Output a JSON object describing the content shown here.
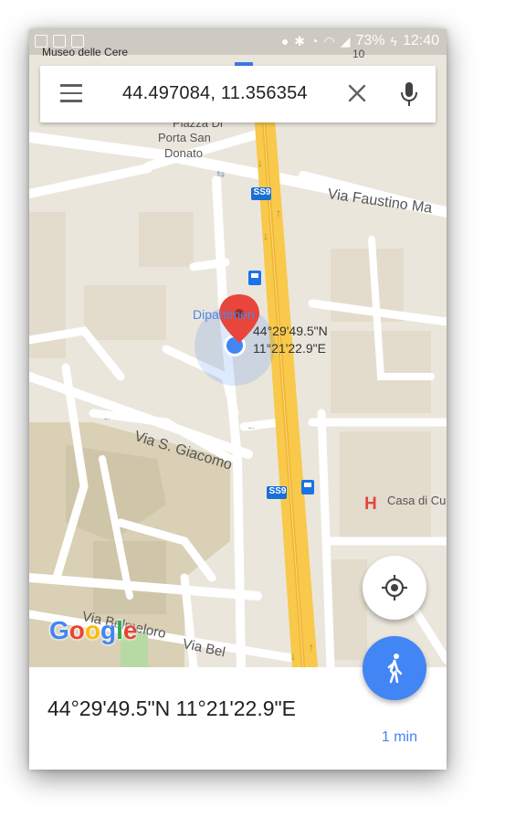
{
  "status_bar": {
    "battery": "73%",
    "time": "12:40"
  },
  "search": {
    "query": "44.497084, 11.356354"
  },
  "map": {
    "labels": {
      "museo": "Museo delle Cere",
      "piazza": "Piazza Di",
      "porta": "Porta San",
      "donato": "Donato",
      "faustino": "Via Faustino Ma",
      "dipart": "Dipartimen",
      "coord_lat": "44°29'49.5\"N",
      "coord_lng": "11°21'22.9\"E",
      "giacomo": "Via S. Giacomo",
      "casa": "Casa di Cu",
      "belmeloro": "Via Belmeloro",
      "via_bel": "Via Bel",
      "ss9_top": "SS9",
      "ss9_bottom": "SS9",
      "road_number": "10"
    },
    "google_logo": {
      "letters": [
        "G",
        "o",
        "o",
        "g",
        "l",
        "e"
      ],
      "colors": [
        "#4285f4",
        "#ea4335",
        "#fbbc05",
        "#4285f4",
        "#34a853",
        "#ea4335"
      ]
    },
    "colors": {
      "background": "#ebe6dc",
      "street": "#ffffff",
      "major_road": "#f8c94a",
      "block": "#e0d8c8",
      "campus": "#d9d0b5",
      "pin": "#e8453c",
      "location_dot": "#4285f4"
    }
  },
  "bottom_sheet": {
    "title": "44°29'49.5\"N 11°21'22.9\"E",
    "eta": "1 min"
  },
  "icons": {
    "menu": "menu-icon",
    "clear": "close-icon",
    "mic": "mic-icon",
    "locate": "my-location-icon",
    "walk": "walk-icon"
  }
}
